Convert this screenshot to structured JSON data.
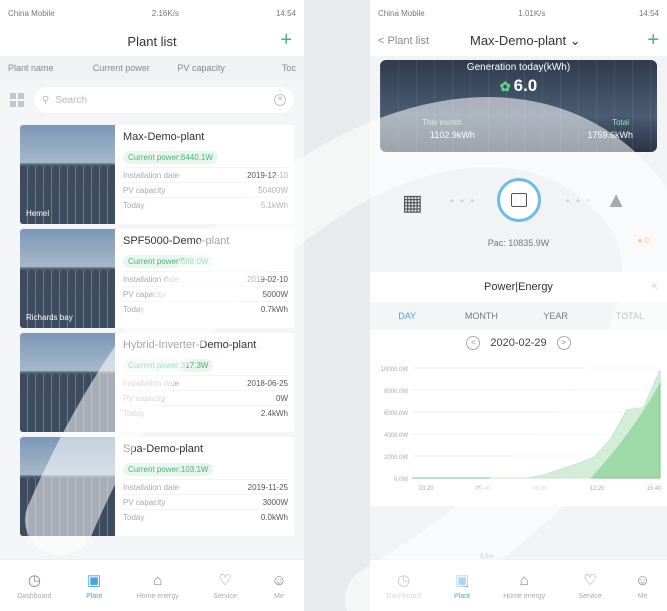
{
  "left": {
    "status": {
      "carrier": "China Mobile",
      "speed": "2.16K/s",
      "time": "14:54"
    },
    "title": "Plant list",
    "plus": "+",
    "columns": [
      "Plant name",
      "Current power",
      "PV capacity",
      "Toc"
    ],
    "search_placeholder": "Search",
    "plants": [
      {
        "name": "Max-Demo-plant",
        "power": "Current power:6440.1W",
        "location": "Hemel",
        "install_label": "Installation date",
        "install": "2019-12-10",
        "pv_label": "PV capacity",
        "pv": "50400W",
        "today_label": "Today",
        "today": "5.1kWh"
      },
      {
        "name": "SPF5000-Demo-plant",
        "power": "Current power:888.0W",
        "location": "Richards bay",
        "install_label": "Installation date",
        "install": "2019-02-10",
        "pv_label": "PV capacity",
        "pv": "5000W",
        "today_label": "Today",
        "today": "0.7kWh"
      },
      {
        "name": "Hybrid-Inverter-Demo-plant",
        "power": "Current power:317.3W",
        "location": "",
        "install_label": "Installation date",
        "install": "2018-06-25",
        "pv_label": "PV capacity",
        "pv": "0W",
        "today_label": "Today",
        "today": "2.4kWh"
      },
      {
        "name": "Spa-Demo-plant",
        "power": "Current power:103.1W",
        "location": "",
        "install_label": "Installation date",
        "install": "2019-11-25",
        "pv_label": "PV capacity",
        "pv": "3000W",
        "today_label": "Today",
        "today": "0.0kWh"
      }
    ],
    "tabs": [
      "Dashboard",
      "Plant",
      "Home energy",
      "Service",
      "Me"
    ]
  },
  "right": {
    "status": {
      "carrier": "China Mobile",
      "speed": "1.01K/s",
      "time": "14:54"
    },
    "back": "< Plant list",
    "title": "Max-Demo-plant",
    "plus": "+",
    "gen_title": "Generation today(kWh)",
    "gen_value": "6.0",
    "month_label": "This month",
    "month_value": "1102.9kWh",
    "total_label": "Total",
    "total_value": "1759.6kWh",
    "pac": "Pac: 10835.9W",
    "alarm": "0",
    "pe_title": "Power|Energy",
    "period_tabs": [
      "DAY",
      "MONTH",
      "YEAR",
      "TOTAL"
    ],
    "date": "2020-02-29",
    "partial_label": "Me...",
    "tabs": [
      "Dashboard",
      "Plant",
      "Home energy",
      "Service",
      "Me"
    ]
  },
  "chart_data": {
    "type": "area",
    "x": [
      "00:00",
      "01:00",
      "02:00",
      "03:00",
      "04:00",
      "05:00",
      "06:00",
      "07:00",
      "08:00",
      "09:00",
      "10:00",
      "11:00",
      "12:00",
      "13:00",
      "14:00",
      "14:50"
    ],
    "x_ticks": [
      "03:20",
      "05:40",
      "09:00",
      "12:20",
      "15:40"
    ],
    "values": [
      0,
      0,
      0,
      0,
      0,
      0,
      0,
      0,
      300,
      800,
      1300,
      1900,
      3500,
      6200,
      6400,
      9800
    ],
    "y_ticks": [
      "10000.0W",
      "8000.0W",
      "6000.0W",
      "4000.0W",
      "2000.0W",
      "0.0W"
    ],
    "ylim": [
      0,
      10000
    ],
    "color": "#9ed9a8"
  }
}
